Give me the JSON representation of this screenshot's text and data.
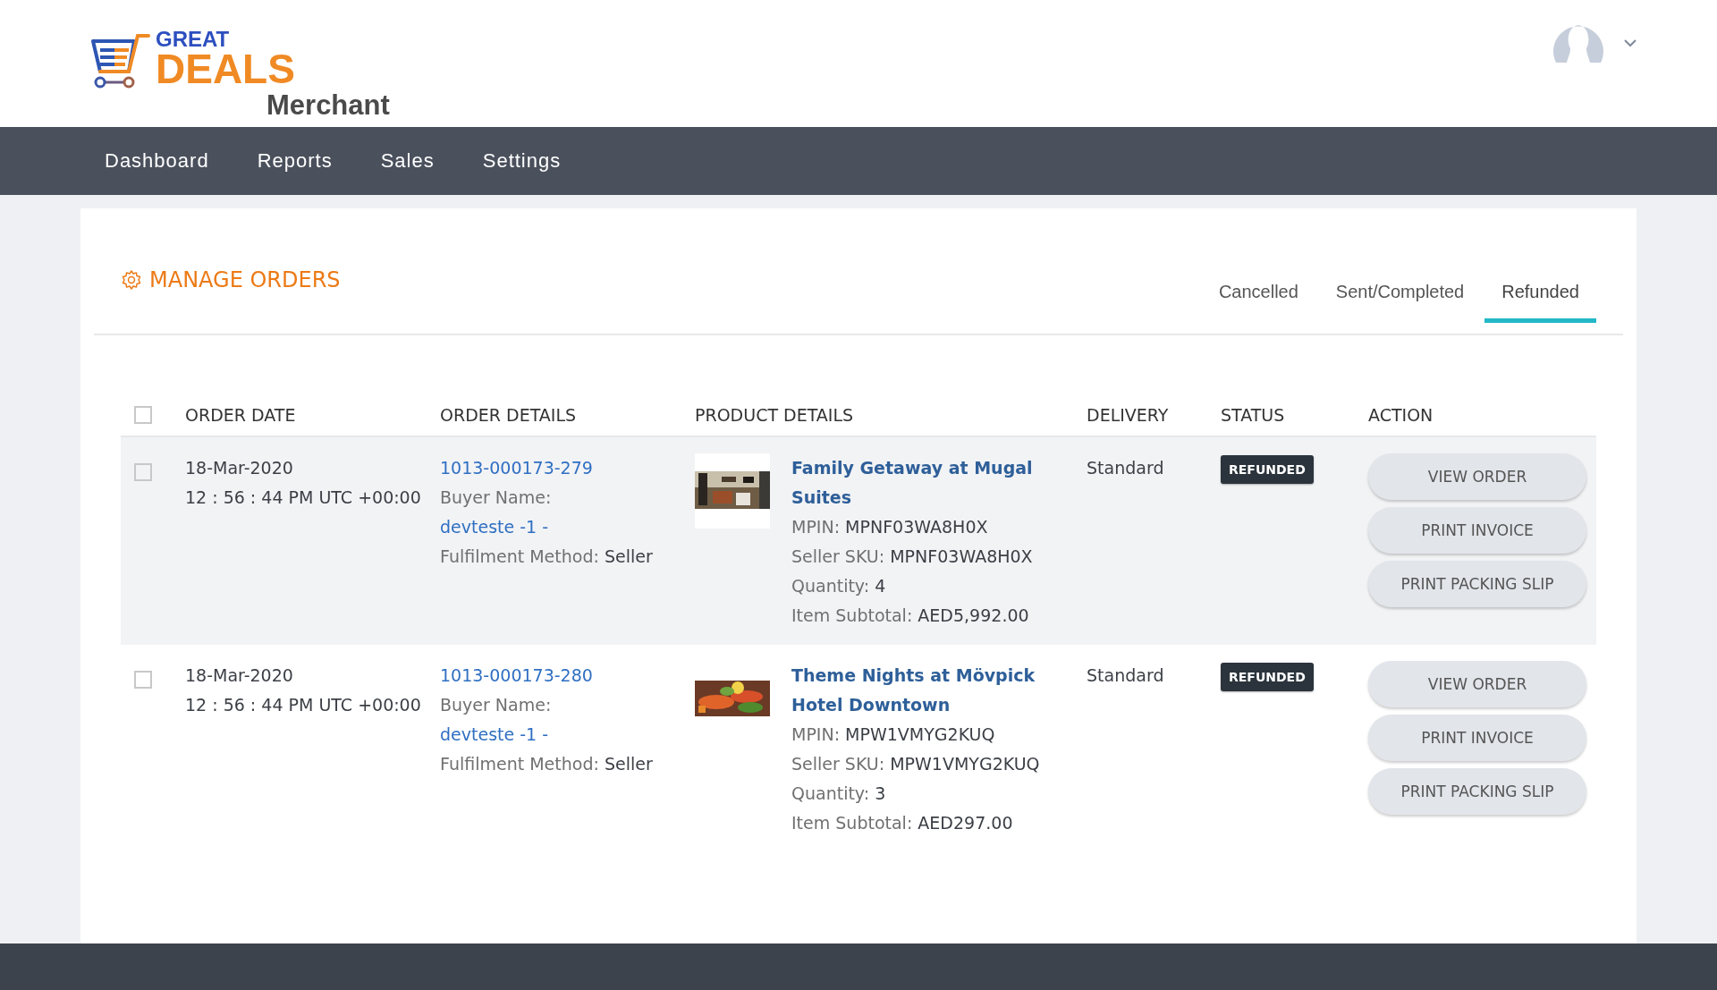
{
  "logo": {
    "line_1": "GREAT",
    "line_2": "DEALS",
    "line_3": "Merchant"
  },
  "nav": [
    {
      "label": "Dashboard"
    },
    {
      "label": "Reports"
    },
    {
      "label": "Sales"
    },
    {
      "label": "Settings"
    }
  ],
  "page_title": "MANAGE ORDERS",
  "tabs": [
    {
      "label": "Cancelled",
      "selected": false
    },
    {
      "label": "Sent/Completed",
      "selected": false
    },
    {
      "label": "Refunded",
      "selected": true
    }
  ],
  "table": {
    "select_all_checked": false,
    "columns": [
      "ORDER DATE",
      "ORDER DETAILS",
      "PRODUCT DETAILS",
      "DELIVERY",
      "STATUS",
      "ACTION"
    ],
    "rows": [
      {
        "checked": false,
        "highlighted": true,
        "date": "18-Mar-2020",
        "time": "12 : 56 : 44 PM UTC +00:00",
        "order_id": "1013-000173-279",
        "buyer_label": "Buyer Name:",
        "buyer": "devteste -1 -",
        "fulfilment_label": "Fulfilment Method:",
        "fulfilment": "Seller",
        "image": {
          "kind": "picture"
        },
        "product": "Family Getaway at Mugal Suites",
        "fields": [
          {
            "label": "MPIN:",
            "value": "MPNF03WA8H0X"
          },
          {
            "label": "Seller SKU:",
            "value": "MPNF03WA8H0X"
          },
          {
            "label": "Quantity:",
            "value": "4"
          },
          {
            "label": "Item Subtotal:",
            "value": "AED5,992.00"
          }
        ],
        "delivery": "Standard",
        "status": "REFUNDED",
        "actions": [
          "VIEW ORDER",
          "PRINT INVOICE",
          "PRINT PACKING SLIP"
        ]
      },
      {
        "checked": false,
        "highlighted": false,
        "date": "18-Mar-2020",
        "time": "12 : 56 : 44 PM UTC +00:00",
        "order_id": "1013-000173-280",
        "buyer_label": "Buyer Name:",
        "buyer": "devteste -1 -",
        "fulfilment_label": "Fulfilment Method:",
        "fulfilment": "Seller",
        "image": {
          "kind": "picture"
        },
        "product": "Theme Nights at Mövpick Hotel Downtown",
        "fields": [
          {
            "label": "MPIN:",
            "value": "MPW1VMYG2KUQ"
          },
          {
            "label": "Seller SKU:",
            "value": "MPW1VMYG2KUQ"
          },
          {
            "label": "Quantity:",
            "value": "3"
          },
          {
            "label": "Item Subtotal:",
            "value": "AED297.00"
          }
        ],
        "delivery": "Standard",
        "status": "REFUNDED",
        "actions": [
          "VIEW ORDER",
          "PRINT INVOICE",
          "PRINT PACKING SLIP"
        ]
      }
    ]
  }
}
